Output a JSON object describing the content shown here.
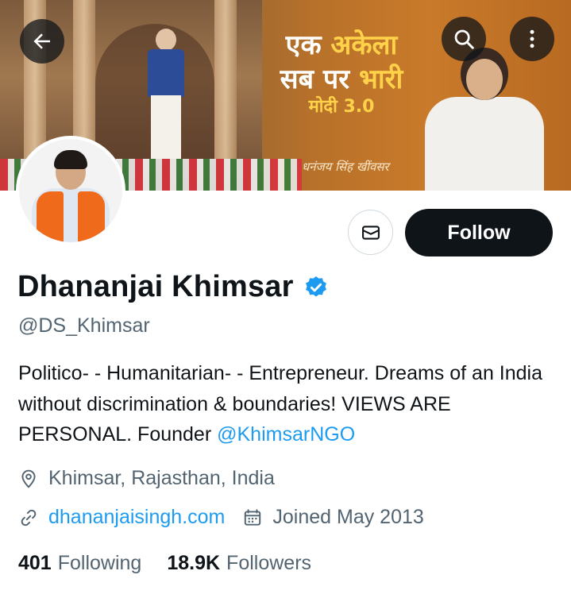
{
  "banner": {
    "headline_line1_white": "एक",
    "headline_line1_yellow": "अकेला",
    "headline_line2_white": "सब पर",
    "headline_line2_yellow": "भारी",
    "headline_line3": "मोदी 3.0",
    "signature": "धनंजय सिंह खींवसर"
  },
  "toolbar": {
    "back_icon": "arrow-left-icon",
    "search_icon": "search-icon",
    "more_icon": "more-vertical-icon"
  },
  "actions": {
    "message_icon": "envelope-icon",
    "follow_label": "Follow"
  },
  "profile": {
    "name": "Dhananjai Khimsar",
    "verified": true,
    "handle": "@DS_Khimsar",
    "bio_text": "Politico- - Humanitarian- - Entrepreneur. Dreams of an India without discrimination & boundaries! VIEWS ARE PERSONAL. Founder ",
    "bio_mention": "@KhimsarNGO",
    "location": "Khimsar, Rajasthan, India",
    "website": "dhananjaisingh.com",
    "joined": "Joined May 2013"
  },
  "stats": {
    "following_count": "401",
    "following_label": "Following",
    "followers_count": "18.9K",
    "followers_label": "Followers"
  },
  "colors": {
    "accent": "#1d9bf0",
    "text_primary": "#0f1419",
    "text_secondary": "#536471",
    "follow_bg": "#0f1419"
  }
}
